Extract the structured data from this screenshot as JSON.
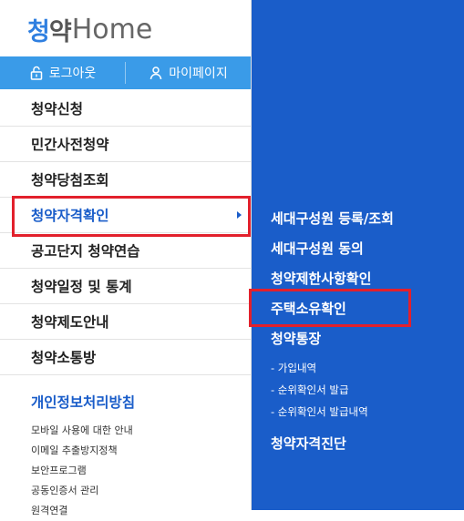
{
  "logo": {
    "part1": "청",
    "part2": "약",
    "part3": "Home"
  },
  "topbar": {
    "logout_label": "로그아웃",
    "mypage_label": "마이페이지"
  },
  "menu": {
    "items": [
      {
        "label": "청약신청"
      },
      {
        "label": "민간사전청약"
      },
      {
        "label": "청약당첨조회"
      },
      {
        "label": "청약자격확인"
      },
      {
        "label": "공고단지 청약연습"
      },
      {
        "label": "청약일정 및 통계"
      },
      {
        "label": "청약제도안내"
      },
      {
        "label": "청약소통방"
      }
    ],
    "active_index": 3
  },
  "footer": {
    "privacy_label": "개인정보처리방침",
    "links": [
      {
        "label": "모바일 사용에 대한 안내"
      },
      {
        "label": "이메일 추출방지정책"
      },
      {
        "label": "보안프로그램"
      },
      {
        "label": "공동인증서 관리"
      },
      {
        "label": "원격연결"
      }
    ]
  },
  "submenu": {
    "items": [
      {
        "label": "세대구성원 등록/조회"
      },
      {
        "label": "세대구성원 동의"
      },
      {
        "label": "청약제한사항확인"
      },
      {
        "label": "주택소유확인"
      },
      {
        "label": "청약통장"
      },
      {
        "label": "- 가입내역"
      },
      {
        "label": "- 순위확인서 발급"
      },
      {
        "label": "- 순위확인서 발급내역"
      },
      {
        "label": "청약자격진단"
      }
    ]
  },
  "colors": {
    "primary": "#1a5dc9",
    "topbar": "#3a9be8",
    "highlight": "#e2202c"
  }
}
